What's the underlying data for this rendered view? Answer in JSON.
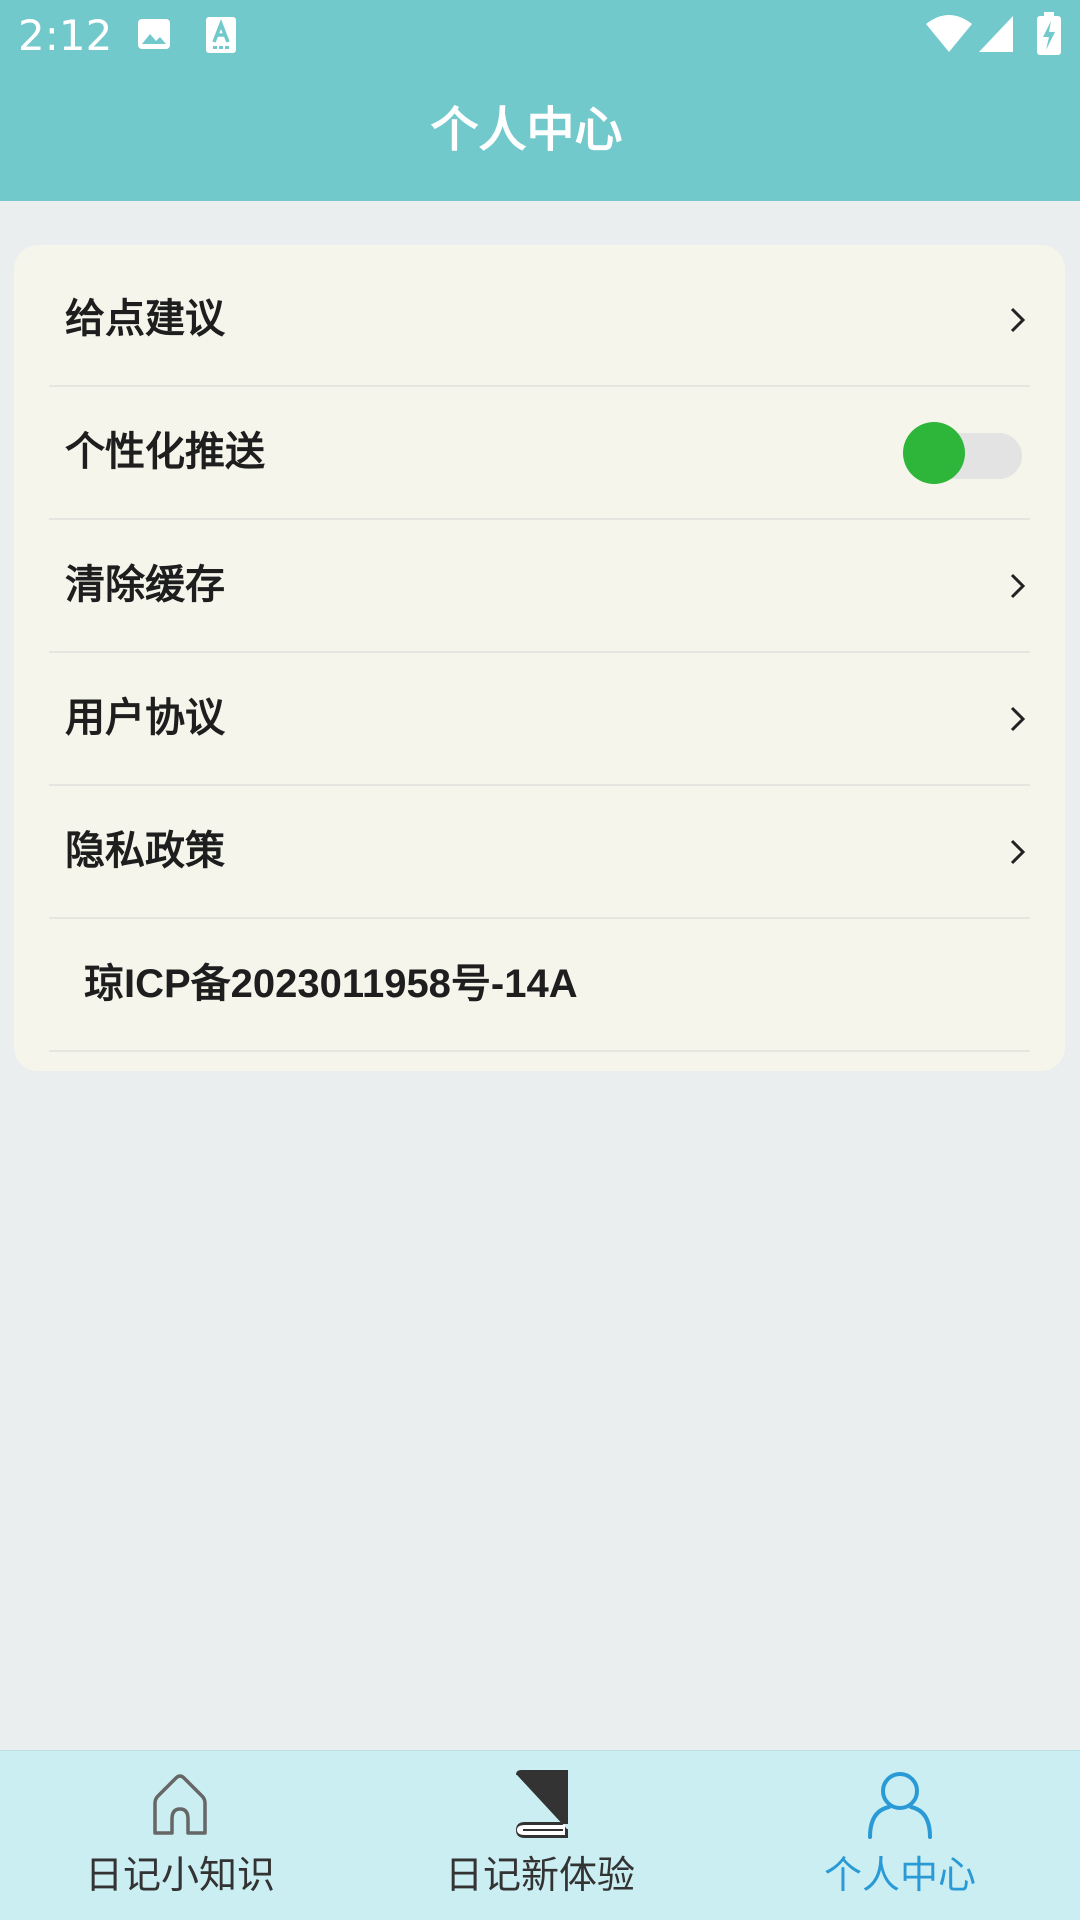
{
  "status_bar": {
    "time": "2:12",
    "icons": [
      "image-icon",
      "text-a-icon",
      "wifi-icon",
      "signal-icon",
      "battery-charging-icon"
    ]
  },
  "header": {
    "title": "个人中心"
  },
  "settings": {
    "items": [
      {
        "label": "给点建议",
        "control": "chevron"
      },
      {
        "label": "个性化推送",
        "control": "toggle",
        "toggle_on": true
      },
      {
        "label": "清除缓存",
        "control": "chevron"
      },
      {
        "label": "用户协议",
        "control": "chevron"
      },
      {
        "label": "隐私政策",
        "control": "chevron"
      },
      {
        "label": "琼ICP备2023011958号-14A",
        "control": "none"
      }
    ]
  },
  "bottom_nav": {
    "items": [
      {
        "label": "日记小知识",
        "icon": "home-icon",
        "active": false
      },
      {
        "label": "日记新体验",
        "icon": "book-icon",
        "active": false
      },
      {
        "label": "个人中心",
        "icon": "person-icon",
        "active": true
      }
    ]
  },
  "colors": {
    "header_bg": "#72c9cc",
    "page_bg": "#ebeeee",
    "card_bg": "#f5f5ec",
    "toggle_on": "#2eb63a",
    "nav_bg": "#cbeef2",
    "nav_active": "#2a9ad6"
  }
}
